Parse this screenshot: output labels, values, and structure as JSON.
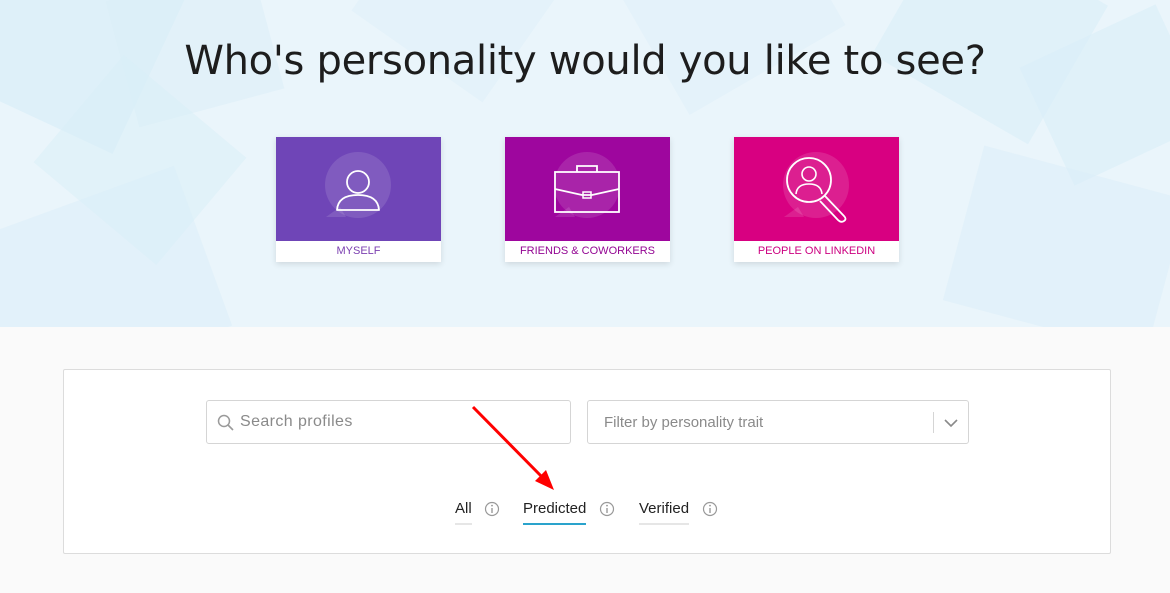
{
  "hero": {
    "title": "Who's personality would you like to see?"
  },
  "cards": [
    {
      "label": "MYSELF",
      "icon": "person-icon",
      "color": "#6f45b7",
      "text_color": "#7b3fb0"
    },
    {
      "label": "FRIENDS & COWORKERS",
      "icon": "briefcase-icon",
      "color": "#9e069e",
      "text_color": "#930693"
    },
    {
      "label": "PEOPLE ON LINKEDIN",
      "icon": "magnify-person-icon",
      "color": "#d80081",
      "text_color": "#cc0080"
    }
  ],
  "search": {
    "placeholder": "Search profiles",
    "value": ""
  },
  "filter": {
    "placeholder": "Filter by personality trait"
  },
  "tabs": [
    {
      "label": "All",
      "active": false
    },
    {
      "label": "Predicted",
      "active": true
    },
    {
      "label": "Verified",
      "active": false
    }
  ],
  "colors": {
    "accent": "#2aa3cc",
    "annotation_arrow": "#ff0000"
  }
}
